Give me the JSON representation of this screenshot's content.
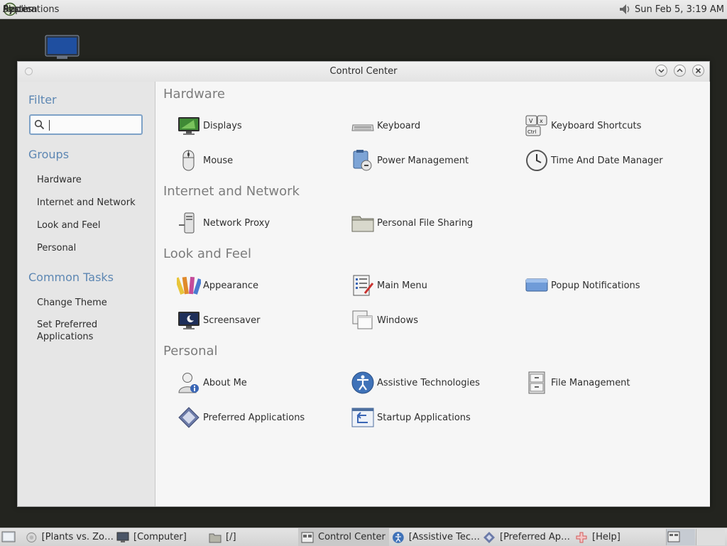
{
  "top_panel": {
    "menus": [
      "Applications",
      "Places",
      "System"
    ],
    "clock": "Sun Feb  5,  3:19 AM"
  },
  "window": {
    "title": "Control Center"
  },
  "sidebar": {
    "filter_label": "Filter",
    "filter_value": "",
    "groups_label": "Groups",
    "groups": [
      "Hardware",
      "Internet and Network",
      "Look and Feel",
      "Personal"
    ],
    "tasks_label": "Common Tasks",
    "tasks": [
      "Change Theme",
      "Set Preferred\nApplications"
    ]
  },
  "sections": [
    {
      "title": "Hardware",
      "items": [
        {
          "label": "Displays",
          "icon": "display-icon"
        },
        {
          "label": "Keyboard",
          "icon": "keyboard-icon"
        },
        {
          "label": "Keyboard Shortcuts",
          "icon": "keyboard-shortcuts-icon"
        },
        {
          "label": "Mouse",
          "icon": "mouse-icon"
        },
        {
          "label": "Power Management",
          "icon": "power-management-icon"
        },
        {
          "label": "Time And Date Manager",
          "icon": "clock-icon"
        }
      ]
    },
    {
      "title": "Internet and Network",
      "items": [
        {
          "label": "Network Proxy",
          "icon": "network-proxy-icon"
        },
        {
          "label": "Personal File Sharing",
          "icon": "file-sharing-icon"
        }
      ]
    },
    {
      "title": "Look and Feel",
      "items": [
        {
          "label": "Appearance",
          "icon": "appearance-icon"
        },
        {
          "label": "Main Menu",
          "icon": "main-menu-icon"
        },
        {
          "label": "Popup Notifications",
          "icon": "popup-notifications-icon"
        },
        {
          "label": "Screensaver",
          "icon": "screensaver-icon"
        },
        {
          "label": "Windows",
          "icon": "windows-icon"
        }
      ]
    },
    {
      "title": "Personal",
      "items": [
        {
          "label": "About Me",
          "icon": "about-me-icon"
        },
        {
          "label": "Assistive Technologies",
          "icon": "accessibility-icon"
        },
        {
          "label": "File Management",
          "icon": "file-management-icon"
        },
        {
          "label": "Preferred Applications",
          "icon": "preferred-applications-icon"
        },
        {
          "label": "Startup Applications",
          "icon": "startup-applications-icon"
        }
      ]
    }
  ],
  "taskbar": {
    "tasks": [
      {
        "label": "[Plants vs. Zo…",
        "icon": "plants-icon"
      },
      {
        "label": "[Computer]",
        "icon": "computer-icon"
      },
      {
        "label": "[/]",
        "icon": "folder-icon"
      },
      {
        "label": "Control Center",
        "icon": "control-center-icon"
      },
      {
        "label": "[Assistive Tec…",
        "icon": "accessibility-icon"
      },
      {
        "label": "[Preferred Ap…",
        "icon": "preferred-applications-icon"
      },
      {
        "label": "[Help]",
        "icon": "help-icon"
      }
    ]
  },
  "colors": {
    "accent": "#5d87b3",
    "desktop": "#23241f",
    "section_title": "#7c7c7c"
  }
}
